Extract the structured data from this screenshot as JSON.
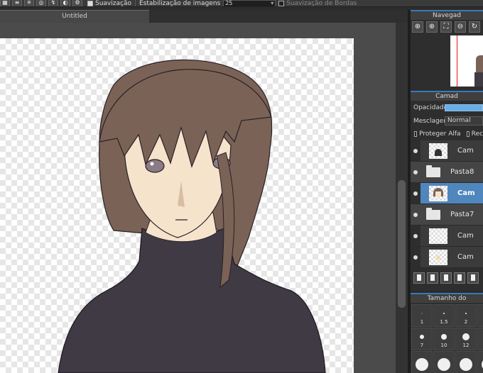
{
  "toolbar": {
    "smoothing_label": "Suavização",
    "stabilization_label": "Estabilização de imagens",
    "stabilization_value": "25",
    "edge_smoothing_label": "Suavização de Bordas",
    "icons": [
      "grid-icon",
      "brush-stroke-icon",
      "radial-icon",
      "concentric-icon",
      "curve-ruler-icon",
      "snap-icon",
      "settings-gear-icon"
    ]
  },
  "document": {
    "tab_title": "Untitled"
  },
  "navigator": {
    "title": "Navegad",
    "icons": [
      "zoom-in-icon",
      "zoom-in-icon",
      "fit-screen-icon",
      "zoom-out-icon",
      "rotate-icon"
    ]
  },
  "layers": {
    "title": "Camad",
    "opacity_label": "Opacidade",
    "opacity_value": 1.0,
    "blend_label": "Mesclagem",
    "blend_value": "Normal",
    "protect_alpha_label": "Proteger Alfa",
    "clip_label": "Rec",
    "items": [
      {
        "name": "Cam",
        "type": "layer",
        "indent": true,
        "selected": false
      },
      {
        "name": "Pasta8",
        "type": "folder",
        "indent": false,
        "selected": false
      },
      {
        "name": "Cam",
        "type": "layer",
        "indent": true,
        "selected": true
      },
      {
        "name": "Pasta7",
        "type": "folder",
        "indent": false,
        "selected": false
      },
      {
        "name": "Cam",
        "type": "layer",
        "indent": true,
        "selected": false
      },
      {
        "name": "Cam",
        "type": "layer",
        "indent": true,
        "selected": false
      }
    ]
  },
  "brush_size": {
    "title": "Tamanho do",
    "sizes": [
      "1",
      "1.5",
      "2",
      "",
      "7",
      "10",
      "12",
      "",
      "",
      "",
      "",
      ""
    ]
  },
  "colors": {
    "accent": "#3b78b9",
    "selected_layer": "#4f86bd",
    "hair": "#7a6256",
    "skin": "#f6e3cc",
    "sweater": "#403a45"
  }
}
